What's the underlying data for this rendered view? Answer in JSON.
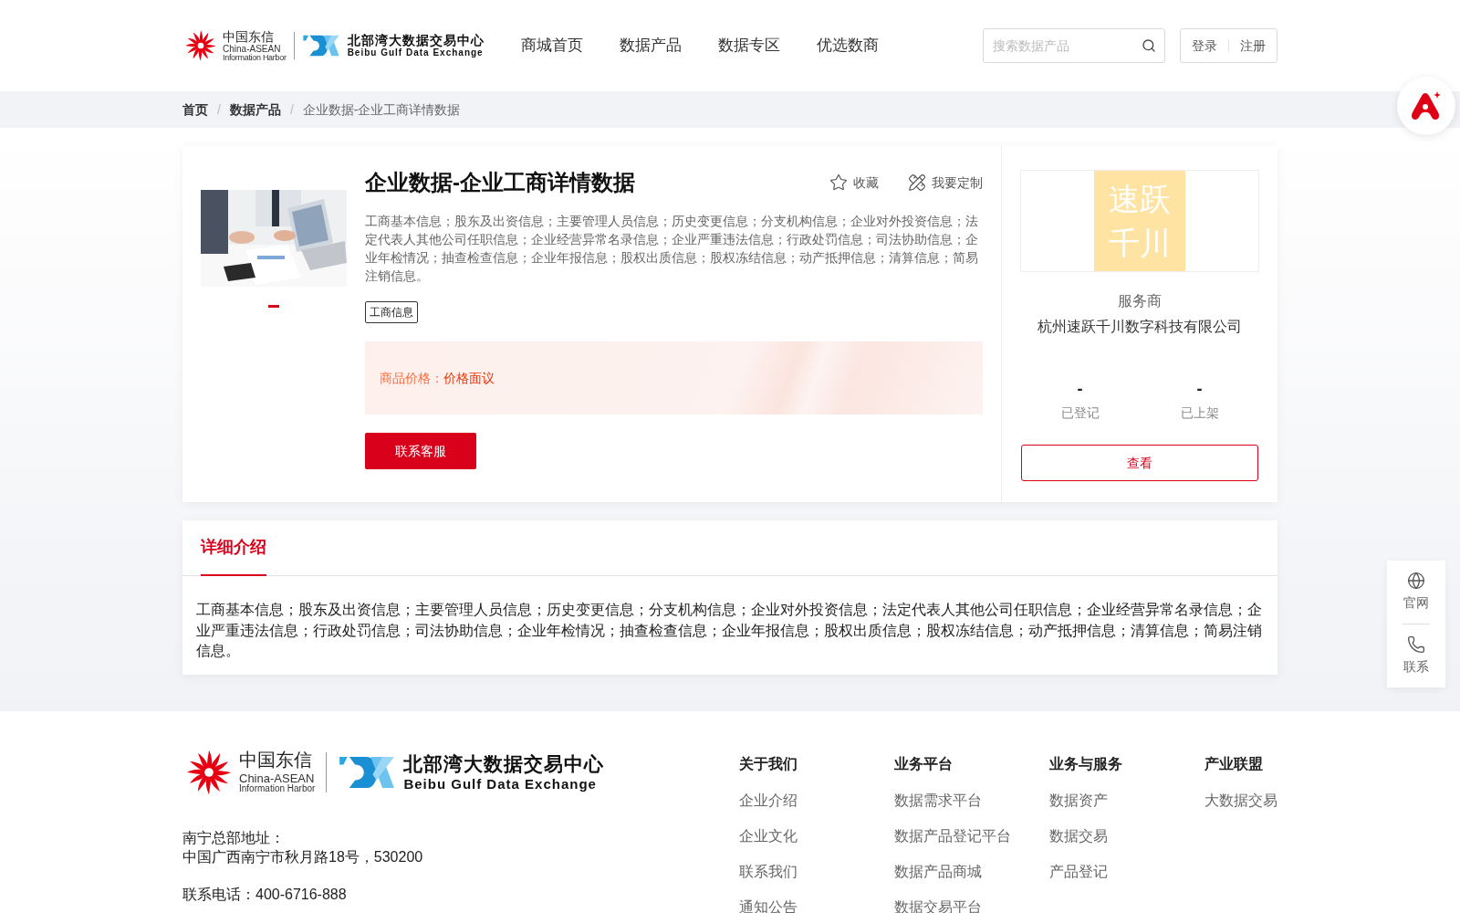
{
  "header": {
    "logo_a": {
      "name": "中国东信",
      "en_line_1": "China-ASEAN",
      "en_line_2": "Information Harbor"
    },
    "logo_b": {
      "name": "北部湾大数据交易中心",
      "en": "Beibu Gulf Data Exchange"
    },
    "nav": [
      {
        "label": "商城首页",
        "selected": false
      },
      {
        "label": "数据产品",
        "selected": false
      },
      {
        "label": "数据专区",
        "selected": false
      },
      {
        "label": "优选数商",
        "selected": false
      }
    ],
    "search": {
      "placeholder": "搜索数据产品"
    },
    "auth": [
      "登录",
      "注册"
    ]
  },
  "breadcrumb": {
    "separator": "/",
    "items": [
      "首页",
      "数据产品",
      "企业数据-企业工商详情数据"
    ]
  },
  "product": {
    "title": "企业数据-企业工商详情数据",
    "actions": [
      {
        "kind": "favorite",
        "label": "收藏"
      },
      {
        "kind": "custom",
        "label": "我要定制"
      }
    ],
    "description": "工商基本信息；股东及出资信息；主要管理人员信息；历史变更信息；分支机构信息；企业对外投资信息；法定代表人其他公司任职信息；企业经营异常名录信息；企业严重违法信息；行政处罚信息；司法协助信息；企业年检情况；抽查检查信息；企业年报信息；股权出质信息；股权冻结信息；动产抵押信息；清算信息；简易注销信息。",
    "tags": [
      "工商信息"
    ],
    "carousel_dots": [
      {
        "selected": true
      }
    ],
    "price_label": "商品价格：",
    "price": "价格面议",
    "contact_button": "联系客服"
  },
  "provider": {
    "logo_lines": [
      "速跃",
      "千川"
    ],
    "role": "服务商",
    "name": "杭州速跃千川数字科技有限公司",
    "stats": [
      {
        "value": "-",
        "label": "已登记"
      },
      {
        "value": "-",
        "label": "已上架"
      }
    ],
    "view_button": "查看"
  },
  "detail": {
    "tabs": [
      {
        "label": "详细介绍",
        "selected": true
      }
    ],
    "text": "工商基本信息；股东及出资信息；主要管理人员信息；历史变更信息；分支机构信息；企业对外投资信息；法定代表人其他公司任职信息；企业经营异常名录信息；企业严重违法信息；行政处罚信息；司法协助信息；企业年检情况；抽查检查信息；企业年报信息；股权出质信息；股权冻结信息；动产抵押信息；清算信息；简易注销信息。"
  },
  "float_tools": [
    {
      "kind": "globe",
      "label": "官网"
    },
    {
      "kind": "phone",
      "label": "联系"
    }
  ],
  "footer": {
    "logo_a": {
      "name": "中国东信",
      "en_line_1": "China-ASEAN",
      "en_line_2": "Information Harbor"
    },
    "logo_b": {
      "name": "北部湾大数据交易中心",
      "en": "Beibu Gulf Data Exchange"
    },
    "address_label": "南宁总部地址：",
    "address": "中国广西南宁市秋月路18号，530200",
    "phone": "联系电话：400-6716-888",
    "columns": [
      {
        "title": "关于我们",
        "links": [
          "企业介绍",
          "企业文化",
          "联系我们",
          "通知公告"
        ]
      },
      {
        "title": "业务平台",
        "links": [
          "数据需求平台",
          "数据产品登记平台",
          "数据产品商城",
          "数据交易平台"
        ]
      },
      {
        "title": "业务与服务",
        "links": [
          "数据资产",
          "数据交易",
          "产品登记"
        ]
      },
      {
        "title": "产业联盟",
        "links": [
          "大数据交易"
        ]
      }
    ]
  }
}
